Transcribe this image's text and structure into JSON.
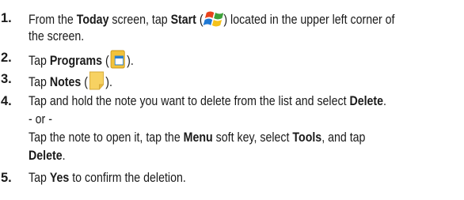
{
  "steps": [
    {
      "number": "1.",
      "line1": {
        "t1": "From the ",
        "b1": "Today",
        "t2": " screen, tap ",
        "b2": "Start",
        "t3": " (",
        "t4": ") located in the upper left corner of"
      },
      "line2": "the screen.",
      "icon": "windows-start-icon"
    },
    {
      "number": "2.",
      "t1": "Tap ",
      "b1": "Programs",
      "t2": " (",
      "t3": ").",
      "icon": "programs-folder-icon"
    },
    {
      "number": "3.",
      "t1": "Tap ",
      "b1": "Notes",
      "t2": " (",
      "t3": ").",
      "icon": "notes-icon"
    },
    {
      "number": "4.",
      "line1": {
        "t1": "Tap and hold the note you want to delete from the list and select ",
        "b1": "Delete",
        "t2": "."
      },
      "or_text": "- or -",
      "line3": {
        "t1": "Tap the note to open it, tap the ",
        "b1": "Menu",
        "t2": " soft key, select ",
        "b2": "Tools",
        "t3": ", and tap"
      },
      "line4": {
        "b1": "Delete",
        "t1": "."
      }
    },
    {
      "number": "5.",
      "t1": "Tap ",
      "b1": "Yes",
      "t2": " to confirm the deletion."
    }
  ],
  "colors": {
    "text": "#1a1a1a",
    "folder_blue": "#2a7fd0",
    "folder_yellow": "#f2c23a",
    "note_yellow": "#f7d262"
  }
}
